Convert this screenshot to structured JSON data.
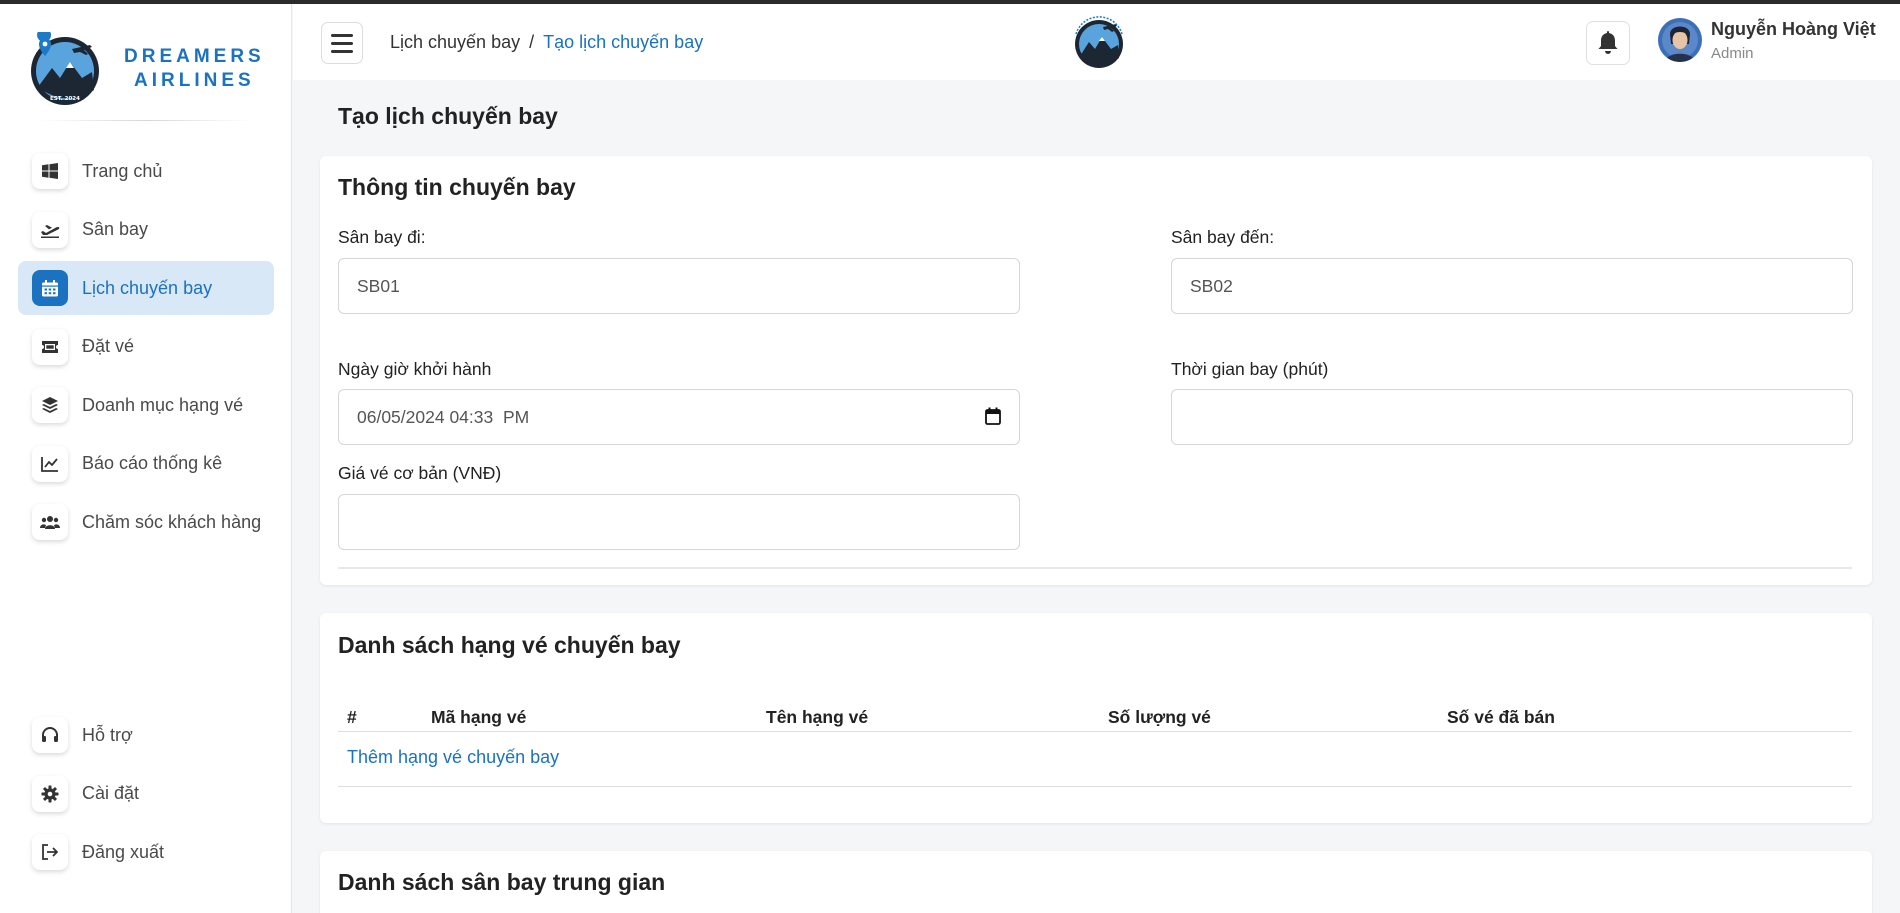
{
  "brand": {
    "line1": "DREAMERS",
    "line2": "AIRLINES"
  },
  "colors": {
    "accent": "#1b72c0",
    "active_bg": "#d8e8f6"
  },
  "sidebar": {
    "items": [
      {
        "label": "Trang chủ",
        "icon": "windows-icon"
      },
      {
        "label": "Sân bay",
        "icon": "plane-departure-icon"
      },
      {
        "label": "Lịch chuyến bay",
        "icon": "calendar-icon",
        "active": true
      },
      {
        "label": "Đặt vé",
        "icon": "ticket-icon"
      },
      {
        "label": "Doanh mục hạng vé",
        "icon": "layers-icon"
      },
      {
        "label": "Báo cáo thống kê",
        "icon": "line-chart-icon"
      },
      {
        "label": "Chăm sóc khách hàng",
        "icon": "users-icon"
      }
    ],
    "bottom_items": [
      {
        "label": "Hỗ trợ",
        "icon": "headset-icon"
      },
      {
        "label": "Cài đặt",
        "icon": "gear-icon"
      },
      {
        "label": "Đăng xuất",
        "icon": "logout-icon"
      }
    ]
  },
  "header": {
    "breadcrumb": [
      "Lịch chuyến bay",
      "/",
      "Tạo lịch chuyến bay"
    ],
    "user": {
      "name": "Nguyễn Hoàng Việt",
      "role": "Admin"
    }
  },
  "main": {
    "page_title": "Tạo lịch chuyến bay",
    "flight_info": {
      "title": "Thông tin chuyến bay",
      "departure_airport": {
        "label": "Sân bay đi:",
        "value": "SB01"
      },
      "arrival_airport": {
        "label": "Sân bay đến:",
        "value": "SB02"
      },
      "departure_datetime": {
        "label": "Ngày giờ khởi hành",
        "value": "06/05/2024 04:33  PM"
      },
      "flight_duration": {
        "label": "Thời gian bay (phút)",
        "value": ""
      },
      "base_price": {
        "label": "Giá vé cơ bản (VNĐ)",
        "value": ""
      }
    },
    "ticket_classes": {
      "title": "Danh sách hạng vé chuyến bay",
      "columns": [
        "#",
        "Mã hạng vé",
        "Tên hạng vé",
        "Số lượng vé",
        "Số vé đã bán"
      ],
      "add_link": "Thêm hạng vé chuyến bay"
    },
    "stopover_airports": {
      "title": "Danh sách sân bay trung gian"
    }
  }
}
